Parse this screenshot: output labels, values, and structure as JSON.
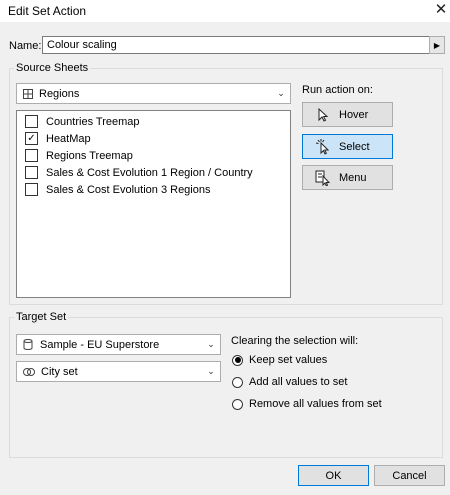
{
  "window": {
    "title": "Edit Set Action",
    "close_glyph": "✕"
  },
  "name": {
    "label": "Name:",
    "value": "Colour scaling"
  },
  "source": {
    "legend": "Source Sheets",
    "datasource": "Regions",
    "sheets": [
      {
        "label": "Countries Treemap",
        "checked": false
      },
      {
        "label": "HeatMap",
        "checked": true
      },
      {
        "label": "Regions Treemap",
        "checked": false
      },
      {
        "label": "Sales & Cost Evolution 1 Region / Country",
        "checked": false
      },
      {
        "label": "Sales & Cost Evolution 3 Regions",
        "checked": false
      }
    ]
  },
  "run_action": {
    "label": "Run action on:",
    "options": [
      {
        "label": "Hover",
        "icon": "hover-pointer-icon"
      },
      {
        "label": "Select",
        "icon": "select-pointer-icon",
        "selected": true
      },
      {
        "label": "Menu",
        "icon": "menu-pointer-icon"
      }
    ]
  },
  "target": {
    "legend": "Target Set",
    "datasource": "Sample - EU Superstore",
    "set": "City set"
  },
  "clearing": {
    "label": "Clearing the selection will:",
    "options": [
      {
        "label": "Keep set values",
        "selected": true
      },
      {
        "label": "Add all values to set",
        "selected": false
      },
      {
        "label": "Remove all values from set",
        "selected": false
      }
    ]
  },
  "footer": {
    "ok": "OK",
    "cancel": "Cancel"
  },
  "colors": {
    "accent": "#0078d7",
    "selected_bg": "#cce4f7"
  }
}
